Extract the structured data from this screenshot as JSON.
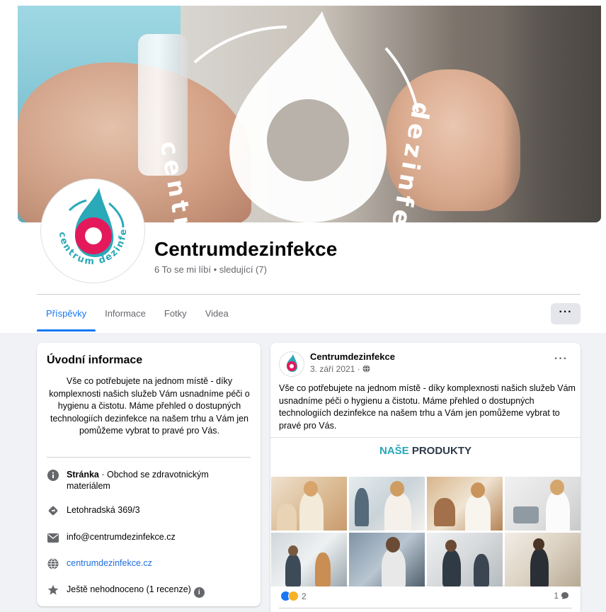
{
  "page": {
    "name": "Centrumdezinfekce",
    "stats": "6 To se mi líbí • sledující (7)"
  },
  "cover": {
    "brand_word_1": "centrum",
    "brand_word_2": "dezinfekce"
  },
  "avatar": {
    "ring_text": "centrum dezinfekce",
    "colors": {
      "teal": "#2aa9b8",
      "pink": "#e4195c"
    }
  },
  "tabs": [
    {
      "label": "Příspěvky",
      "active": true
    },
    {
      "label": "Informace",
      "active": false
    },
    {
      "label": "Fotky",
      "active": false
    },
    {
      "label": "Videa",
      "active": false
    }
  ],
  "more_button": "···",
  "intro": {
    "title": "Úvodní informace",
    "bio": "Vše co potřebujete na jednom místě - díky komplexnosti našich služeb Vám usnadníme péči o hygienu a čistotu. Máme přehled o dostupných technologiích dezinfekce na našem trhu a Vám jen pomůžeme vybrat to pravé pro Vás.",
    "rows": [
      {
        "icon": "info-icon",
        "label_bold": "Stránka",
        "label": " · Obchod se zdravotnickým materiálem"
      },
      {
        "icon": "location-icon",
        "label": "Letohradská 369/3"
      },
      {
        "icon": "email-icon",
        "label": "info@centrumdezinfekce.cz"
      },
      {
        "icon": "globe-icon",
        "label": "centrumdezinfekce.cz"
      },
      {
        "icon": "star-icon",
        "label": "Ještě nehodnoceno (1 recenze)"
      }
    ]
  },
  "post": {
    "author": "Centrumdezinfekce",
    "date": "3. září 2021 ·",
    "more": "···",
    "text": "Vše co potřebujete na jednom místě - díky komplexnosti našich služeb Vám usnadníme péči o hygienu a čistotu. Máme přehled o dostupných technologiích dezinfekce na našem trhu a Vám jen pomůžeme vybrat to pravé pro Vás.",
    "image_title_a": "NAŠE",
    "image_title_b": " PRODUKTY",
    "reaction_count": "2",
    "comment_count": "1"
  },
  "colors": {
    "accent": "#1877f2",
    "link": "#216fdb",
    "brand_teal": "#28a6b8",
    "brand_pink": "#e4195c"
  }
}
